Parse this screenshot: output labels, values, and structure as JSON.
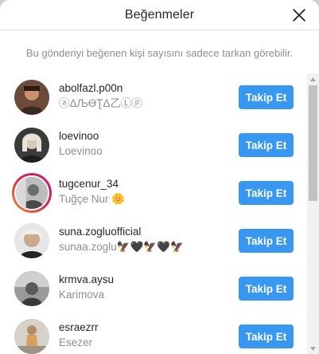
{
  "dialog": {
    "title": "Beğenmeler",
    "notice": "Bu gönderiyi beğenen kişi sayısını sadece tarkan görebilir.",
    "icons": {
      "close": "close-icon",
      "scroll_up": "arrow-up-icon",
      "scroll_down": "arrow-down-icon"
    }
  },
  "users": [
    {
      "username": "abolfazl.p00n",
      "fullname": "ⓐΔЉƟƮΔ乙Ⓛⓟ",
      "button": "Takip Et"
    },
    {
      "username": "loevinoo",
      "fullname": "Loevinoo",
      "button": "Takip Et"
    },
    {
      "username": "tugcenur_34",
      "fullname": "Tuğçe Nur 🌼",
      "button": "Takip Et"
    },
    {
      "username": "suna.zogluofficial",
      "fullname": "sunaa.zoglu🦅🖤🦅🖤🦅",
      "button": "Takip Et"
    },
    {
      "username": "krmva.aysu",
      "fullname": "Karimova",
      "button": "Takip Et"
    },
    {
      "username": "esraezrr",
      "fullname": "Esezer",
      "button": "Takip Et"
    }
  ],
  "colors": {
    "button": "#3897f0",
    "muted": "#8e8e8e",
    "text": "#262626",
    "story_ring": "#dc2743"
  }
}
